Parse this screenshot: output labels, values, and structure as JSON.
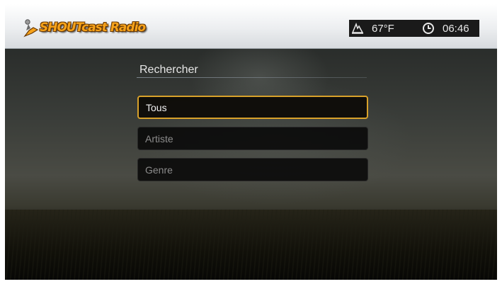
{
  "header": {
    "logo_text": "SHOUTcast Radio",
    "temperature": "67°F",
    "time": "06:46",
    "weather_icon": "weather-icon",
    "clock_icon": "clock-icon"
  },
  "panel": {
    "title": "Rechercher",
    "items": [
      {
        "label": "Tous",
        "selected": true
      },
      {
        "label": "Artiste",
        "selected": false
      },
      {
        "label": "Genre",
        "selected": false
      }
    ]
  },
  "colors": {
    "accent": "#d8a12a",
    "logo": "#f6a21a"
  }
}
